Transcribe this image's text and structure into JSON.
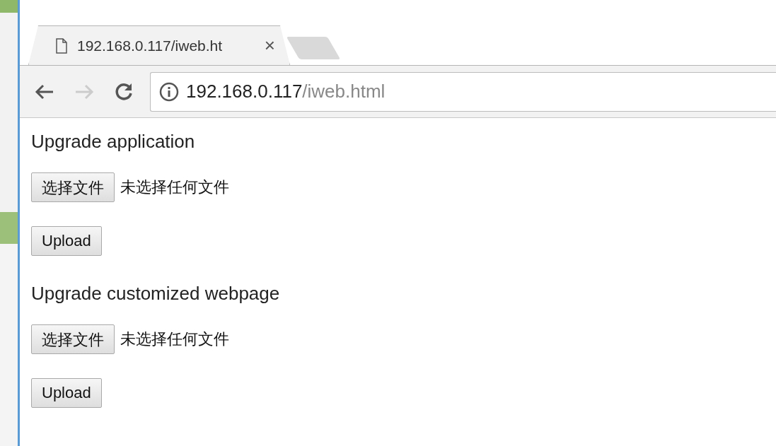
{
  "browser": {
    "tab": {
      "title": "192.168.0.117/iweb.ht",
      "close": "×"
    },
    "url": {
      "host": "192.168.0.117",
      "path": "/iweb.html"
    },
    "back_enabled": true,
    "forward_enabled": false
  },
  "sections": [
    {
      "heading": "Upgrade application",
      "choose_button": "选择文件",
      "file_status": "未选择任何文件",
      "upload_button": "Upload"
    },
    {
      "heading": "Upgrade customized webpage",
      "choose_button": "选择文件",
      "file_status": "未选择任何文件",
      "upload_button": "Upload"
    }
  ]
}
